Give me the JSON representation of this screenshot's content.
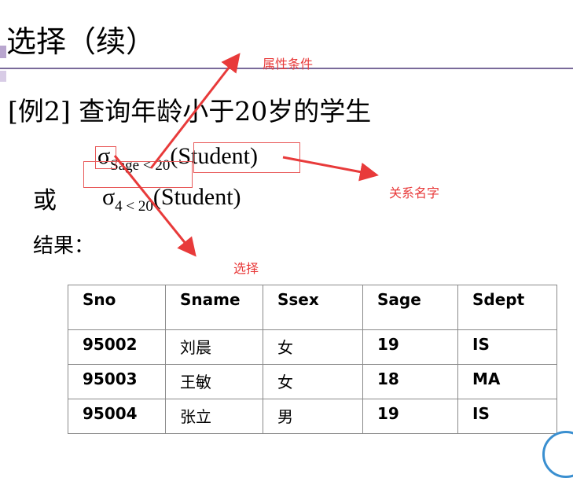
{
  "title": "选择（续）",
  "example": "[例2]  查询年龄小于20岁的学生",
  "expr1": {
    "sigma": "σ",
    "subscript": "Sage < 20",
    "relation": "(Student)"
  },
  "or_label": "或",
  "expr2": {
    "sigma": "σ",
    "subscript": "4 < 20",
    "relation": "(Student)"
  },
  "result_label": "结果：",
  "annotations": {
    "attr_condition": "属性条件",
    "relation_name": "关系名字",
    "selection": "选择"
  },
  "colors": {
    "annotation": "#e83a3a",
    "title_rule": "#7a6a9a"
  },
  "table": {
    "headers": [
      "Sno",
      "Sname",
      "Ssex",
      "Sage",
      "Sdept"
    ],
    "rows": [
      [
        "95002",
        "刘晨",
        "女",
        "19",
        "IS"
      ],
      [
        "95003",
        "王敏",
        "女",
        "18",
        "MA"
      ],
      [
        "95004",
        "张立",
        "男",
        "19",
        "IS"
      ]
    ]
  }
}
